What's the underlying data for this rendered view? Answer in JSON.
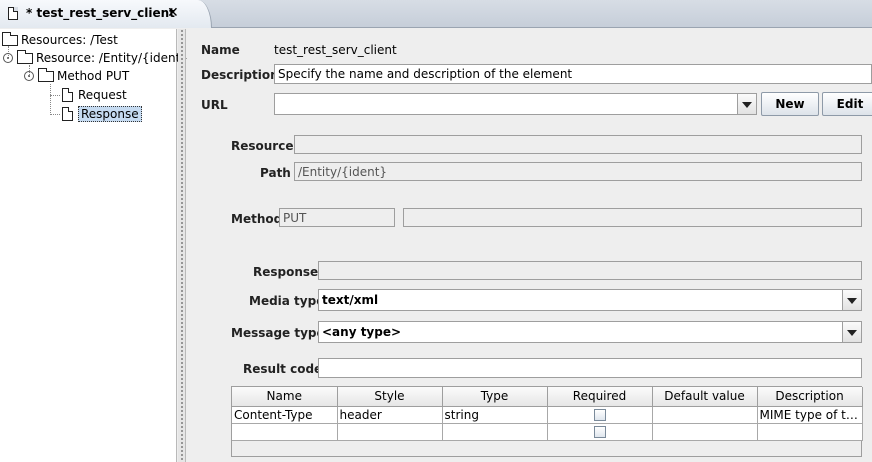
{
  "tab": {
    "title": "* test_rest_serv_client",
    "close": "✕"
  },
  "tree": {
    "items": [
      {
        "label": "Resources: /Test"
      },
      {
        "label": "Resource: /Entity/{ident}"
      },
      {
        "label": "Method PUT"
      },
      {
        "label": "Request"
      },
      {
        "label": "Response"
      }
    ]
  },
  "form": {
    "name_label": "Name",
    "name_value": "test_rest_serv_client",
    "description_label": "Description",
    "description_value": "Specify the name and description of the element",
    "url_label": "URL",
    "url_value": "",
    "new_button": "New",
    "edit_button": "Edit",
    "resource_label": "Resource",
    "resource_value": "",
    "path_label": "Path",
    "path_value": "/Entity/{ident}",
    "method_label": "Method",
    "method_value": "PUT",
    "method_extra": "",
    "response_label": "Response",
    "response_value": "",
    "media_type_label": "Media type",
    "media_type_value": "text/xml",
    "message_type_label": "Message type",
    "message_type_value": "<any type>",
    "result_code_label": "Result code",
    "result_code_value": ""
  },
  "params_table": {
    "columns": [
      "Name",
      "Style",
      "Type",
      "Required",
      "Default value",
      "Description"
    ],
    "rows": [
      {
        "name": "Content-Type",
        "style": "header",
        "type": "string",
        "required": false,
        "default": "",
        "description": "MIME type of the ..."
      },
      {
        "name": "",
        "style": "",
        "type": "",
        "required": false,
        "default": "",
        "description": ""
      }
    ]
  },
  "icons": {
    "tab": "document-icon",
    "close": "close-icon",
    "folder": "folder-icon",
    "file": "file-icon",
    "dropdown": "chevron-down-icon"
  }
}
